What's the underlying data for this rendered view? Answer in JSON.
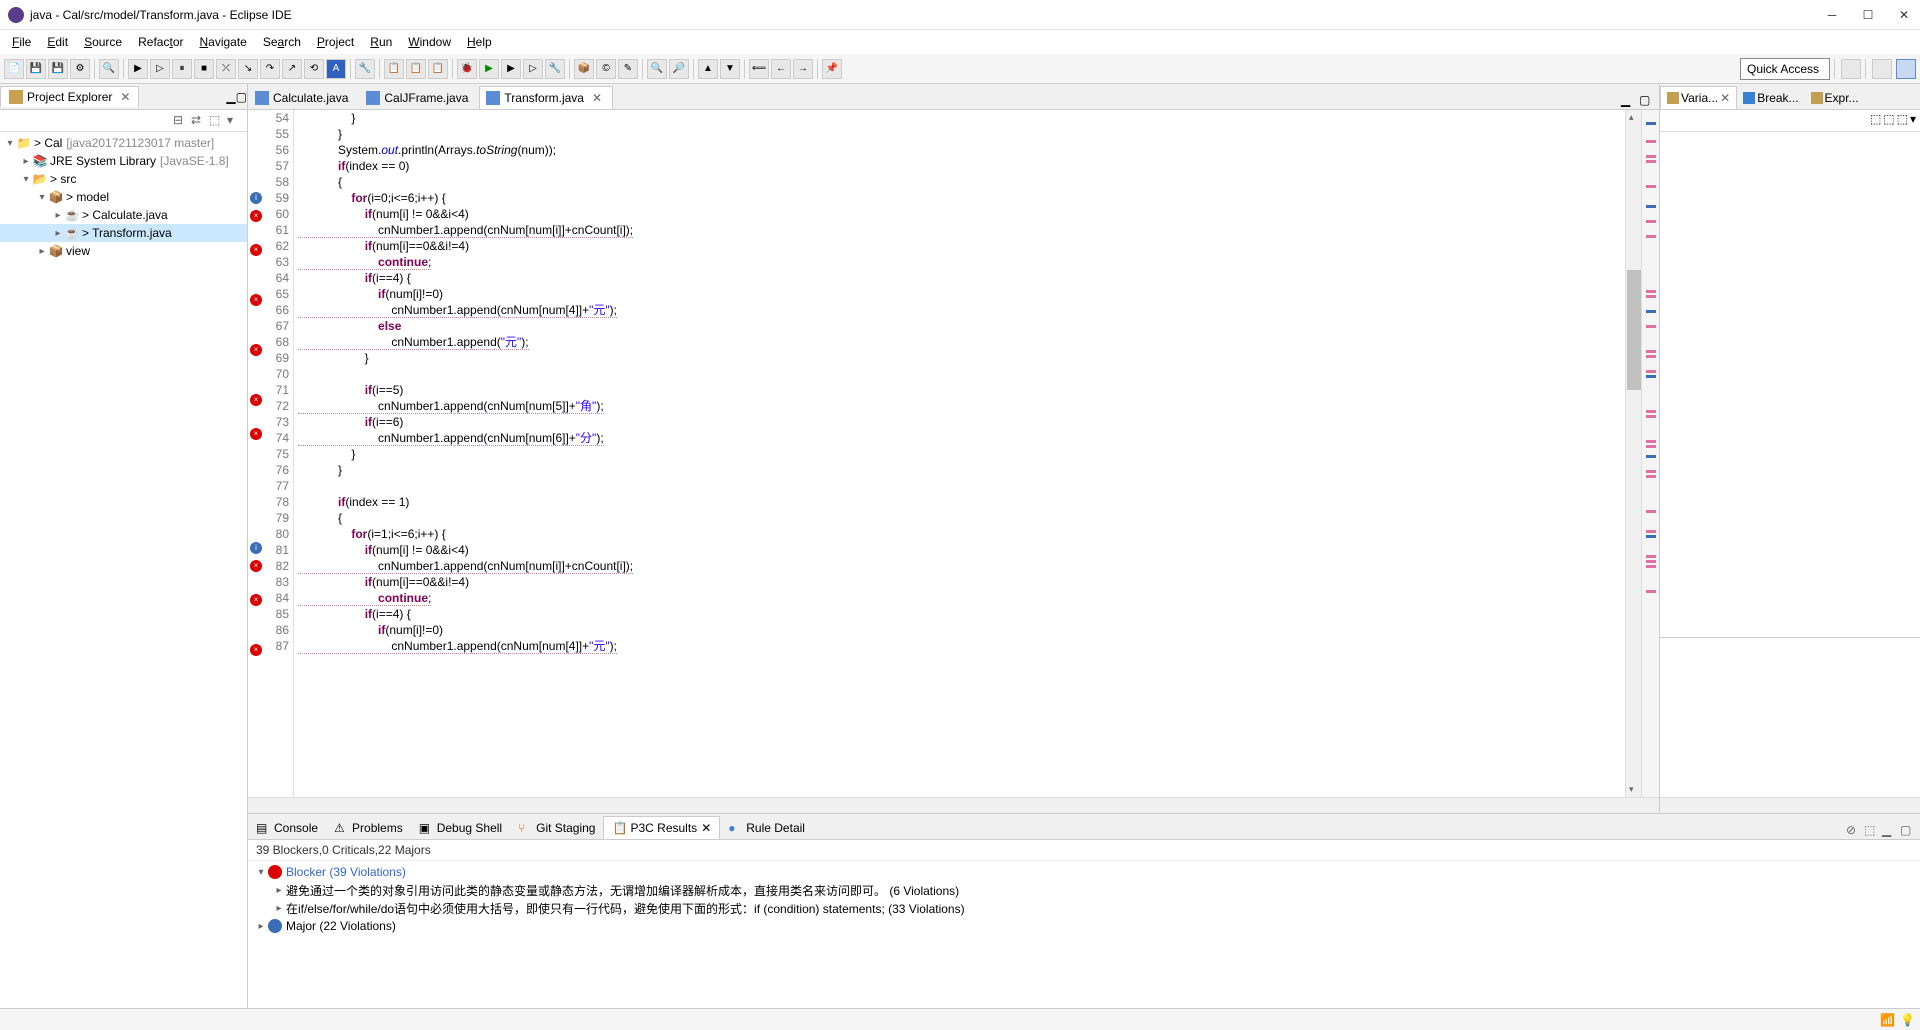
{
  "window_title": "java - Cal/src/model/Transform.java - Eclipse IDE",
  "menu": [
    "File",
    "Edit",
    "Source",
    "Refactor",
    "Navigate",
    "Search",
    "Project",
    "Run",
    "Window",
    "Help"
  ],
  "quick_access": "Quick Access",
  "explorer": {
    "title": "Project Explorer",
    "tree": {
      "project": "Cal",
      "project_decor": "[java201721123017 master]",
      "jre": "JRE System Library",
      "jre_decor": "[JavaSE-1.8]",
      "src": "src",
      "pkg_model": "model",
      "file_calc": "Calculate.java",
      "file_trans": "Transform.java",
      "pkg_view": "view"
    }
  },
  "editor_tabs": [
    {
      "label": "Calculate.java",
      "active": false
    },
    {
      "label": "CalJFrame.java",
      "active": false
    },
    {
      "label": "Transform.java",
      "active": true
    }
  ],
  "line_start": 54,
  "code_lines": [
    {
      "n": 54,
      "t": "                }",
      "m": ""
    },
    {
      "n": 55,
      "t": "            }",
      "m": ""
    },
    {
      "n": 56,
      "t": "            System.out.println(Arrays.toString(num));",
      "m": "",
      "out": true
    },
    {
      "n": 57,
      "t": "            if(index == 0)",
      "m": "",
      "kw": [
        "if"
      ]
    },
    {
      "n": 58,
      "t": "            {",
      "m": ""
    },
    {
      "n": 59,
      "t": "                for(i=0;i<=6;i++) {",
      "m": "info",
      "kw": [
        "for"
      ]
    },
    {
      "n": 60,
      "t": "                    if(num[i] != 0&&i<4)",
      "m": "err",
      "kw": [
        "if"
      ]
    },
    {
      "n": 61,
      "t": "                        cnNumber1.append(cnNum[num[i]]+cnCount[i]);",
      "m": "",
      "sq": true
    },
    {
      "n": 62,
      "t": "                    if(num[i]==0&&i!=4)",
      "m": "err",
      "kw": [
        "if"
      ]
    },
    {
      "n": 63,
      "t": "                        continue;",
      "m": "",
      "kw": [
        "continue"
      ],
      "sq": true
    },
    {
      "n": 64,
      "t": "                    if(i==4) {",
      "m": "",
      "kw": [
        "if"
      ]
    },
    {
      "n": 65,
      "t": "                        if(num[i]!=0)",
      "m": "err",
      "kw": [
        "if"
      ]
    },
    {
      "n": 66,
      "t": "                            cnNumber1.append(cnNum[num[4]]+\"元\");",
      "m": "",
      "sq": true,
      "str": true
    },
    {
      "n": 67,
      "t": "                        else",
      "m": "",
      "kw": [
        "else"
      ]
    },
    {
      "n": 68,
      "t": "                            cnNumber1.append(\"元\");",
      "m": "err",
      "sq": true,
      "str": true
    },
    {
      "n": 69,
      "t": "                    }",
      "m": ""
    },
    {
      "n": 70,
      "t": "",
      "m": ""
    },
    {
      "n": 71,
      "t": "                    if(i==5)",
      "m": "err",
      "kw": [
        "if"
      ]
    },
    {
      "n": 72,
      "t": "                        cnNumber1.append(cnNum[num[5]]+\"角\");",
      "m": "",
      "sq": true,
      "str": true
    },
    {
      "n": 73,
      "t": "                    if(i==6)",
      "m": "err",
      "kw": [
        "if"
      ]
    },
    {
      "n": 74,
      "t": "                        cnNumber1.append(cnNum[num[6]]+\"分\");",
      "m": "",
      "sq": true,
      "str": true
    },
    {
      "n": 75,
      "t": "                }",
      "m": ""
    },
    {
      "n": 76,
      "t": "            }",
      "m": ""
    },
    {
      "n": 77,
      "t": "",
      "m": ""
    },
    {
      "n": 78,
      "t": "            if(index == 1)",
      "m": "",
      "kw": [
        "if"
      ]
    },
    {
      "n": 79,
      "t": "            {",
      "m": ""
    },
    {
      "n": 80,
      "t": "                for(i=1;i<=6;i++) {",
      "m": "info",
      "kw": [
        "for"
      ]
    },
    {
      "n": 81,
      "t": "                    if(num[i] != 0&&i<4)",
      "m": "err",
      "kw": [
        "if"
      ]
    },
    {
      "n": 82,
      "t": "                        cnNumber1.append(cnNum[num[i]]+cnCount[i]);",
      "m": "",
      "sq": true
    },
    {
      "n": 83,
      "t": "                    if(num[i]==0&&i!=4)",
      "m": "err",
      "kw": [
        "if"
      ]
    },
    {
      "n": 84,
      "t": "                        continue;",
      "m": "",
      "kw": [
        "continue"
      ],
      "sq": true
    },
    {
      "n": 85,
      "t": "                    if(i==4) {",
      "m": "",
      "kw": [
        "if"
      ]
    },
    {
      "n": 86,
      "t": "                        if(num[i]!=0)",
      "m": "err",
      "kw": [
        "if"
      ]
    },
    {
      "n": 87,
      "t": "                            cnNumber1.append(cnNum[num[4]]+\"元\");",
      "m": "",
      "sq": true,
      "str": true
    }
  ],
  "right_tabs": [
    {
      "label": "Varia...",
      "active": true
    },
    {
      "label": "Break...",
      "active": false
    },
    {
      "label": "Expr...",
      "active": false
    }
  ],
  "bottom": {
    "tabs": [
      {
        "label": "Console"
      },
      {
        "label": "Problems"
      },
      {
        "label": "Debug Shell"
      },
      {
        "label": "Git Staging"
      },
      {
        "label": "P3C Results",
        "active": true
      },
      {
        "label": "Rule Detail"
      }
    ],
    "summary": "39 Blockers,0 Criticals,22 Majors",
    "blocker_label": "Blocker (39 Violations)",
    "rule1": "避免通过一个类的对象引用访问此类的静态变量或静态方法，无谓增加编译器解析成本，直接用类名来访问即可。 (6 Violations)",
    "rule2": "在if/else/for/while/do语句中必须使用大括号，即使只有一行代码，避免使用下面的形式：if (condition) statements; (33 Violations)",
    "major_label": "Major (22 Violations)"
  }
}
